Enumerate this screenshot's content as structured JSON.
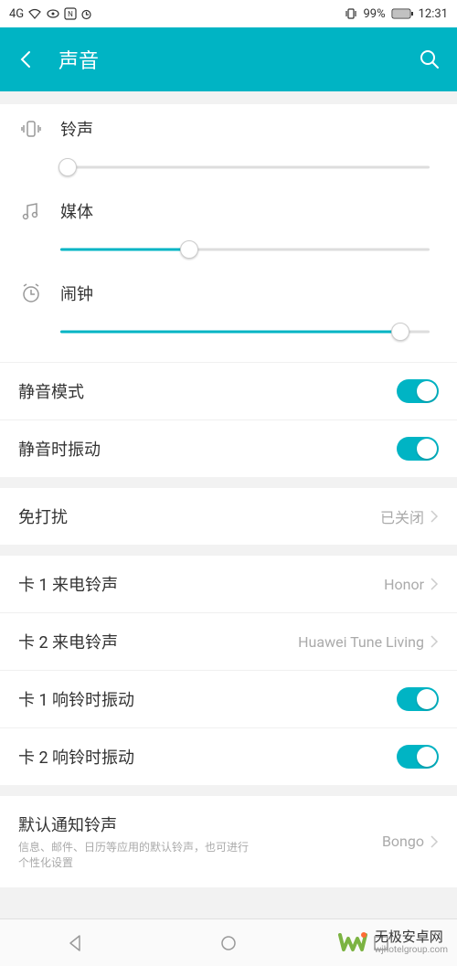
{
  "status": {
    "network": "4G",
    "battery_pct": "99%",
    "time": "12:31"
  },
  "header": {
    "title": "声音"
  },
  "sliders": {
    "ringtone": {
      "label": "铃声",
      "value": 2
    },
    "media": {
      "label": "媒体",
      "value": 35
    },
    "alarm": {
      "label": "闹钟",
      "value": 92
    }
  },
  "toggles": {
    "silent_mode": {
      "label": "静音模式",
      "on": true
    },
    "vibrate_silent": {
      "label": "静音时振动",
      "on": true
    },
    "sim1_vibrate_ring": {
      "label": "卡 1 响铃时振动",
      "on": true
    },
    "sim2_vibrate_ring": {
      "label": "卡 2 响铃时振动",
      "on": true
    }
  },
  "links": {
    "dnd": {
      "label": "免打扰",
      "value": "已关闭"
    },
    "sim1_ringtone": {
      "label": "卡 1 来电铃声",
      "value": "Honor"
    },
    "sim2_ringtone": {
      "label": "卡 2 来电铃声",
      "value": "Huawei Tune Living"
    },
    "default_notification": {
      "label": "默认通知铃声",
      "subtitle": "信息、邮件、日历等应用的默认铃声，也可进行个性化设置",
      "value": "Bongo"
    }
  },
  "watermark": {
    "title": "无极安卓网",
    "url": "wjhotelgroup.com"
  }
}
